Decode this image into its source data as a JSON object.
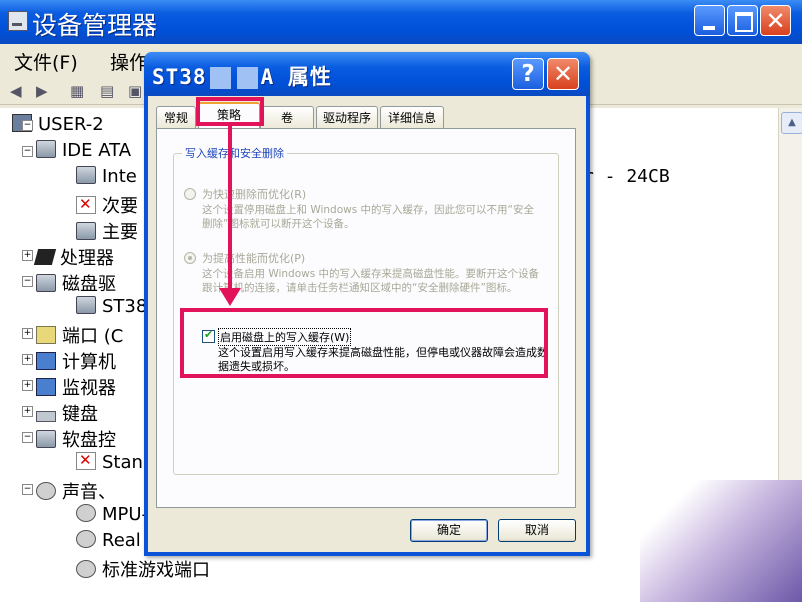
{
  "main_window": {
    "title": "设备管理器",
    "menu": [
      "文件(F)",
      "操作"
    ]
  },
  "tree": {
    "rows": [
      {
        "label": "USER-2"
      },
      {
        "label": "IDE ATA"
      },
      {
        "label": "Inte"
      },
      {
        "label": "次要"
      },
      {
        "label": "主要"
      },
      {
        "label": "处理器"
      },
      {
        "label": "磁盘驱"
      },
      {
        "label": "ST38"
      },
      {
        "label": "端口 (C"
      },
      {
        "label": "计算机"
      },
      {
        "label": "监视器"
      },
      {
        "label": "键盘"
      },
      {
        "label": "软盘控"
      },
      {
        "label": "Stan"
      },
      {
        "label": "声音、"
      },
      {
        "label": "MPU-"
      },
      {
        "label": "Real"
      },
      {
        "label": "标准游戏端口"
      }
    ],
    "right_text": "r - 24CB"
  },
  "dialog": {
    "title_prefix": "ST38",
    "title_mid": "A",
    "title_suffix": "属性",
    "help_glyph": "?",
    "close_glyph": "✕",
    "tabs": [
      "常规",
      "策略",
      "卷",
      "驱动程序",
      "详细信息"
    ],
    "active_tab": "策略",
    "group_title": "写入缓存和安全删除",
    "option1": {
      "label": "为快速删除而优化(R)",
      "desc": "这个设置停用磁盘上和 Windows 中的写入缓存，因此您可以不用“安全删除”图标就可以断开这个设备。"
    },
    "option2": {
      "label": "为提高性能而优化(P)",
      "desc": "这个设备启用 Windows 中的写入缓存来提高磁盘性能。要断开这个设备跟计算机的连接，请单击任务栏通知区域中的“安全删除硬件”图标。"
    },
    "checkbox": {
      "label": "启用磁盘上的写入缓存(W)",
      "desc": "这个设置启用写入缓存来提高磁盘性能，但停电或仪器故障会造成数据遗失或损坏。",
      "checked": true
    },
    "ok_label": "确定",
    "cancel_label": "取消"
  },
  "colors": {
    "title_blue": "#0a5ce0",
    "annotation": "#e3135a",
    "close_red": "#d8401e"
  }
}
